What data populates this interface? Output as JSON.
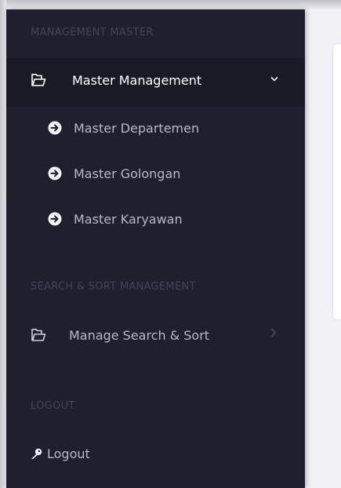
{
  "sections": {
    "management_master": "MANAGEMENT MASTER",
    "search_sort": "SEARCH & SORT MANAGEMENT",
    "logout": "LOGOUT"
  },
  "menu": {
    "master_management": {
      "label": "Master Management",
      "icon": "folder-open-icon",
      "expanded": true,
      "children": [
        {
          "label": "Master Departemen",
          "icon": "arrow-circle-right-icon"
        },
        {
          "label": "Master Golongan",
          "icon": "arrow-circle-right-icon"
        },
        {
          "label": "Master Karyawan",
          "icon": "arrow-circle-right-icon"
        }
      ]
    },
    "manage_search_sort": {
      "label": "Manage Search & Sort",
      "icon": "folder-open-icon",
      "expanded": false
    },
    "logout": {
      "label": "Logout",
      "icon": "key-icon"
    }
  },
  "colors": {
    "sidebar_bg": "#1f1f2d",
    "active_item_bg": "#1a1a26",
    "section_title": "#44445e",
    "main_bg": "#f1f1f6"
  }
}
